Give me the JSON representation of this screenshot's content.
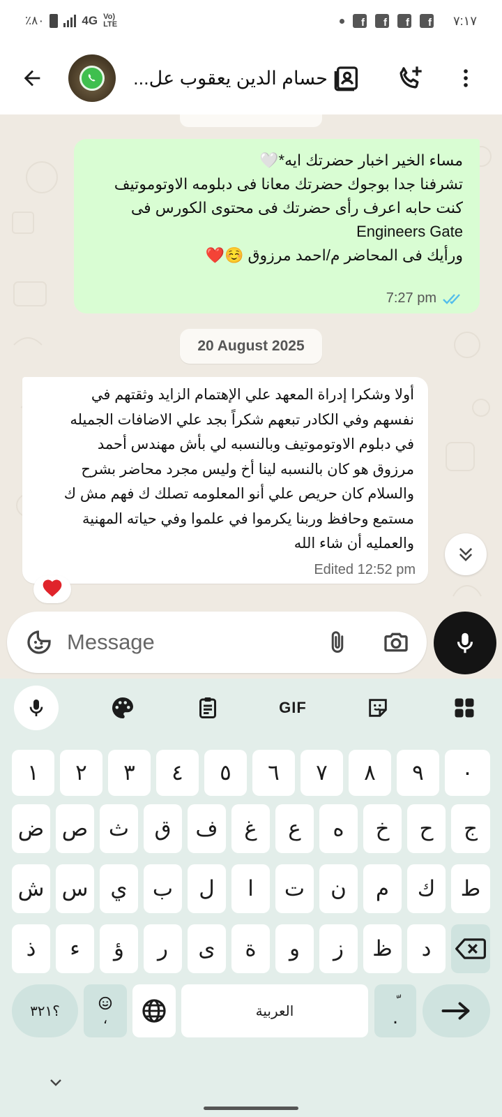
{
  "status_bar": {
    "battery_text": "٪٨٠",
    "network": "4G",
    "volte": "Vo) LTE",
    "time": "٧:١٧",
    "notification_icons": [
      "facebook-icon",
      "facebook-icon",
      "facebook-icon",
      "facebook-icon"
    ]
  },
  "header": {
    "contact_name": "حسام الدين يعقوب عل..."
  },
  "messages": {
    "outgoing": {
      "lines": [
        "مساء الخير اخبار حضرتك ايه*🤍",
        "تشرفنا جدا بوجوك حضرتك معانا فى دبلومه الاوتوموتيف",
        "كنت حابه اعرف رأى حضرتك فى محتوى الكورس فى",
        "Engineers Gate",
        "ورأيك فى المحاضر م/احمد مرزوق ☺️❤️"
      ],
      "time": "7:27 pm",
      "status": "read"
    },
    "date_chip": "20 August 2025",
    "incoming": {
      "lines": [
        "أولا وشكرا إدراة المعهد علي الإهتمام الزايد وثقتهم في",
        "نفسهم وفي الكادر تبعهم شكراً بجد علي الاضافات الجميله",
        "في دبلوم الاوتوموتيف وبالنسبه لي بأش مهندس أحمد",
        "مرزوق هو كان بالنسبه لينا أخ وليس مجرد محاضر بشرح",
        "والسلام كان حريص علي أنو المعلومه تصلك ك فهم مش ك",
        "مستمع وحافظ وربنا يكرموا في علموا وفي حياته المهنية",
        "والعمليه أن شاء الله"
      ],
      "meta": "Edited 12:52 pm",
      "reaction": "❤️"
    }
  },
  "composer": {
    "placeholder": "Message"
  },
  "keyboard": {
    "toolbar": [
      "voice-input",
      "theme",
      "clipboard",
      "GIF",
      "stickers",
      "more-menu"
    ],
    "gif_label": "GIF",
    "rows": [
      [
        "١",
        "٢",
        "٣",
        "٤",
        "٥",
        "٦",
        "٧",
        "٨",
        "٩",
        "٠"
      ],
      [
        "ض",
        "ص",
        "ث",
        "ق",
        "ف",
        "غ",
        "ع",
        "ه",
        "خ",
        "ح",
        "ج"
      ],
      [
        "ش",
        "س",
        "ي",
        "ب",
        "ل",
        "ا",
        "ت",
        "ن",
        "م",
        "ك",
        "ط"
      ],
      [
        "ذ",
        "ء",
        "ؤ",
        "ر",
        "ى",
        "ة",
        "و",
        "ز",
        "ظ",
        "د"
      ]
    ],
    "symbols_label": "؟٣٢١",
    "emoji_key_sub": "،",
    "space_label": "العربية",
    "punct_top": "ّ",
    "punct_bottom": "."
  },
  "colors": {
    "outgoing_bubble": "#d9fdd3",
    "incoming_bubble": "#ffffff",
    "chat_background": "#efeae2",
    "read_ticks": "#53bdeb",
    "keyboard_background": "#e3eeea",
    "modifier_key": "#cfe3df"
  }
}
